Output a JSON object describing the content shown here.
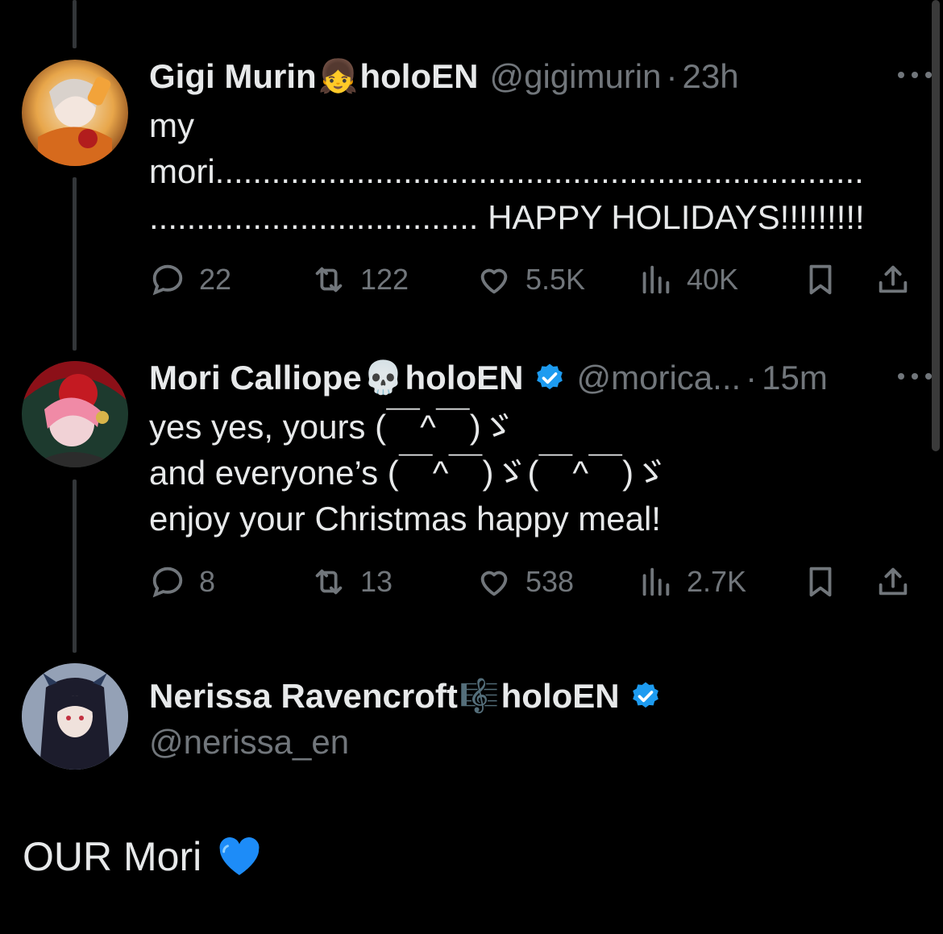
{
  "tweets": [
    {
      "name": "Gigi Murin",
      "name_emoji": "👧",
      "name_suffix": "holoEN",
      "handle": "@gigimurin",
      "dot": "·",
      "time": "23h",
      "lines": [
        "my",
        "mori.....................................................................",
        "................................... HAPPY HOLIDAYS!!!!!!!!!"
      ],
      "replies": "22",
      "reposts": "122",
      "likes": "5.5K",
      "views": "40K",
      "avatar_icon": "gigi-avatar"
    },
    {
      "name": "Mori Calliope",
      "name_emoji": "💀",
      "name_suffix": "holoEN",
      "handle": "@morica...",
      "dot": "·",
      "time": "15m",
      "lines": [
        "yes yes, yours (￣^￣)ゞ",
        "and everyone’s (￣^￣)ゞ(￣^￣)ゞ",
        "enjoy your Christmas happy meal!"
      ],
      "replies": "8",
      "reposts": "13",
      "likes": "538",
      "views": "2.7K",
      "avatar_icon": "mori-avatar"
    }
  ],
  "main_post": {
    "name": "Nerissa Ravencroft",
    "name_emoji": "🎼",
    "name_suffix": "holoEN",
    "handle": "@nerissa_en",
    "text": "OUR Mori",
    "text_emoji": "blue-heart-icon",
    "avatar_icon": "nerissa-avatar"
  },
  "colors": {
    "background": "#000000",
    "text": "#e7e9ea",
    "muted": "#71767b",
    "verified": "#1d9bf0",
    "heart": "#1d8cf8"
  }
}
